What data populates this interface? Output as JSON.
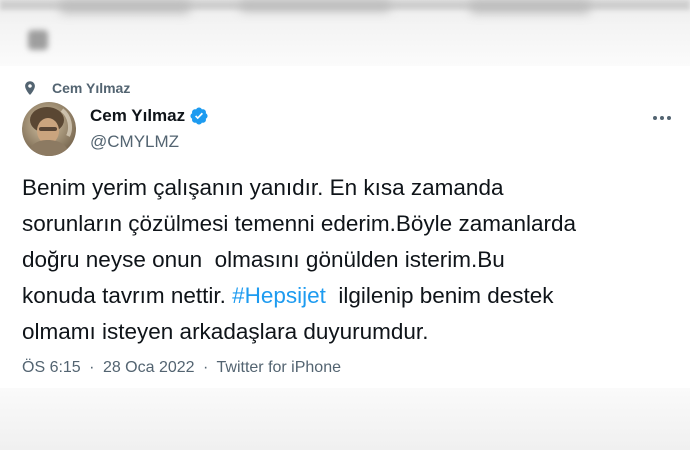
{
  "context": {
    "label": "Cem Yılmaz"
  },
  "author": {
    "name": "Cem Yılmaz",
    "handle": "@CMYLMZ",
    "verified": true
  },
  "tweet": {
    "line1": "Benim yerim çalışanın yanıdır. En kısa zamanda",
    "line2": "sorunların çözülmesi temenni ederim.Böyle zamanlarda",
    "line3": "doğru neyse onun  olmasını gönülden isterim.Bu",
    "line4_before": "konuda tavrım nettir. ",
    "hashtag": "#Hepsijet",
    "line4_after": "  ilgilenip benim destek",
    "line5": "olmamı isteyen arkadaşlara duyurumdur."
  },
  "meta": {
    "time": "ÖS 6:15",
    "separator": "·",
    "date": "28 Oca 2022",
    "source": "Twitter for iPhone"
  },
  "colors": {
    "text": "#0f1419",
    "secondary": "#536471",
    "accent": "#1d9bf0"
  }
}
